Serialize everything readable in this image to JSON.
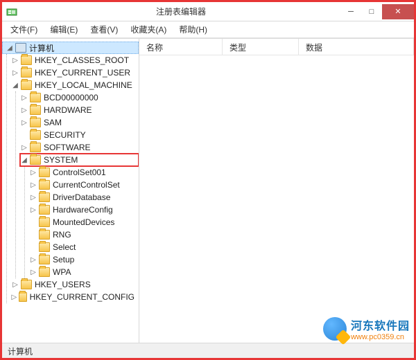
{
  "window": {
    "title": "注册表编辑器"
  },
  "menu": {
    "file": "文件(F)",
    "edit": "编辑(E)",
    "view": "查看(V)",
    "favorites": "收藏夹(A)",
    "help": "帮助(H)"
  },
  "columns": {
    "name": "名称",
    "type": "类型",
    "data": "数据"
  },
  "tree": {
    "root": "计算机",
    "hkcr": "HKEY_CLASSES_ROOT",
    "hkcu": "HKEY_CURRENT_USER",
    "hklm": "HKEY_LOCAL_MACHINE",
    "hklm_children": {
      "bcd": "BCD00000000",
      "hardware": "HARDWARE",
      "sam": "SAM",
      "security": "SECURITY",
      "software": "SOFTWARE",
      "system": "SYSTEM",
      "system_children": {
        "cs001": "ControlSet001",
        "ccs": "CurrentControlSet",
        "drvdb": "DriverDatabase",
        "hwcfg": "HardwareConfig",
        "mdev": "MountedDevices",
        "rng": "RNG",
        "select": "Select",
        "setup": "Setup",
        "wpa": "WPA"
      }
    },
    "hku": "HKEY_USERS",
    "hkcc": "HKEY_CURRENT_CONFIG"
  },
  "statusbar": "计算机",
  "watermark": {
    "line1": "河东软件园",
    "line2": "www.pc0359.cn"
  }
}
